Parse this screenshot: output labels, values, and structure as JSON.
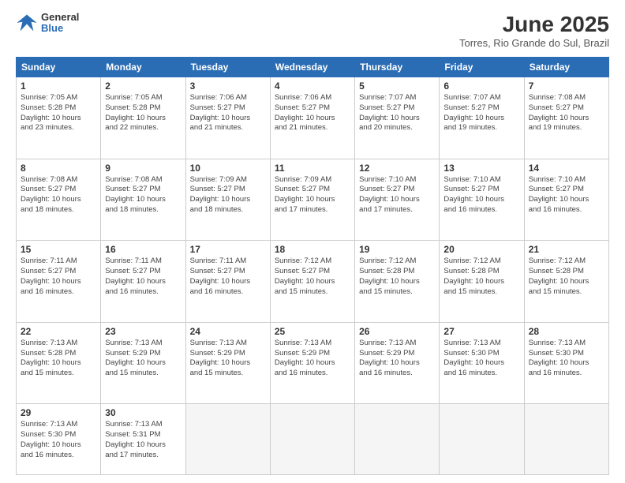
{
  "header": {
    "logo_general": "General",
    "logo_blue": "Blue",
    "title": "June 2025",
    "location": "Torres, Rio Grande do Sul, Brazil"
  },
  "calendar": {
    "weekdays": [
      "Sunday",
      "Monday",
      "Tuesday",
      "Wednesday",
      "Thursday",
      "Friday",
      "Saturday"
    ],
    "weeks": [
      [
        {
          "day": "1",
          "info": "Sunrise: 7:05 AM\nSunset: 5:28 PM\nDaylight: 10 hours\nand 23 minutes."
        },
        {
          "day": "2",
          "info": "Sunrise: 7:05 AM\nSunset: 5:28 PM\nDaylight: 10 hours\nand 22 minutes."
        },
        {
          "day": "3",
          "info": "Sunrise: 7:06 AM\nSunset: 5:27 PM\nDaylight: 10 hours\nand 21 minutes."
        },
        {
          "day": "4",
          "info": "Sunrise: 7:06 AM\nSunset: 5:27 PM\nDaylight: 10 hours\nand 21 minutes."
        },
        {
          "day": "5",
          "info": "Sunrise: 7:07 AM\nSunset: 5:27 PM\nDaylight: 10 hours\nand 20 minutes."
        },
        {
          "day": "6",
          "info": "Sunrise: 7:07 AM\nSunset: 5:27 PM\nDaylight: 10 hours\nand 19 minutes."
        },
        {
          "day": "7",
          "info": "Sunrise: 7:08 AM\nSunset: 5:27 PM\nDaylight: 10 hours\nand 19 minutes."
        }
      ],
      [
        {
          "day": "8",
          "info": "Sunrise: 7:08 AM\nSunset: 5:27 PM\nDaylight: 10 hours\nand 18 minutes."
        },
        {
          "day": "9",
          "info": "Sunrise: 7:08 AM\nSunset: 5:27 PM\nDaylight: 10 hours\nand 18 minutes."
        },
        {
          "day": "10",
          "info": "Sunrise: 7:09 AM\nSunset: 5:27 PM\nDaylight: 10 hours\nand 18 minutes."
        },
        {
          "day": "11",
          "info": "Sunrise: 7:09 AM\nSunset: 5:27 PM\nDaylight: 10 hours\nand 17 minutes."
        },
        {
          "day": "12",
          "info": "Sunrise: 7:10 AM\nSunset: 5:27 PM\nDaylight: 10 hours\nand 17 minutes."
        },
        {
          "day": "13",
          "info": "Sunrise: 7:10 AM\nSunset: 5:27 PM\nDaylight: 10 hours\nand 16 minutes."
        },
        {
          "day": "14",
          "info": "Sunrise: 7:10 AM\nSunset: 5:27 PM\nDaylight: 10 hours\nand 16 minutes."
        }
      ],
      [
        {
          "day": "15",
          "info": "Sunrise: 7:11 AM\nSunset: 5:27 PM\nDaylight: 10 hours\nand 16 minutes."
        },
        {
          "day": "16",
          "info": "Sunrise: 7:11 AM\nSunset: 5:27 PM\nDaylight: 10 hours\nand 16 minutes."
        },
        {
          "day": "17",
          "info": "Sunrise: 7:11 AM\nSunset: 5:27 PM\nDaylight: 10 hours\nand 16 minutes."
        },
        {
          "day": "18",
          "info": "Sunrise: 7:12 AM\nSunset: 5:27 PM\nDaylight: 10 hours\nand 15 minutes."
        },
        {
          "day": "19",
          "info": "Sunrise: 7:12 AM\nSunset: 5:28 PM\nDaylight: 10 hours\nand 15 minutes."
        },
        {
          "day": "20",
          "info": "Sunrise: 7:12 AM\nSunset: 5:28 PM\nDaylight: 10 hours\nand 15 minutes."
        },
        {
          "day": "21",
          "info": "Sunrise: 7:12 AM\nSunset: 5:28 PM\nDaylight: 10 hours\nand 15 minutes."
        }
      ],
      [
        {
          "day": "22",
          "info": "Sunrise: 7:13 AM\nSunset: 5:28 PM\nDaylight: 10 hours\nand 15 minutes."
        },
        {
          "day": "23",
          "info": "Sunrise: 7:13 AM\nSunset: 5:29 PM\nDaylight: 10 hours\nand 15 minutes."
        },
        {
          "day": "24",
          "info": "Sunrise: 7:13 AM\nSunset: 5:29 PM\nDaylight: 10 hours\nand 15 minutes."
        },
        {
          "day": "25",
          "info": "Sunrise: 7:13 AM\nSunset: 5:29 PM\nDaylight: 10 hours\nand 16 minutes."
        },
        {
          "day": "26",
          "info": "Sunrise: 7:13 AM\nSunset: 5:29 PM\nDaylight: 10 hours\nand 16 minutes."
        },
        {
          "day": "27",
          "info": "Sunrise: 7:13 AM\nSunset: 5:30 PM\nDaylight: 10 hours\nand 16 minutes."
        },
        {
          "day": "28",
          "info": "Sunrise: 7:13 AM\nSunset: 5:30 PM\nDaylight: 10 hours\nand 16 minutes."
        }
      ],
      [
        {
          "day": "29",
          "info": "Sunrise: 7:13 AM\nSunset: 5:30 PM\nDaylight: 10 hours\nand 16 minutes."
        },
        {
          "day": "30",
          "info": "Sunrise: 7:13 AM\nSunset: 5:31 PM\nDaylight: 10 hours\nand 17 minutes."
        },
        {
          "day": "",
          "info": ""
        },
        {
          "day": "",
          "info": ""
        },
        {
          "day": "",
          "info": ""
        },
        {
          "day": "",
          "info": ""
        },
        {
          "day": "",
          "info": ""
        }
      ]
    ]
  }
}
